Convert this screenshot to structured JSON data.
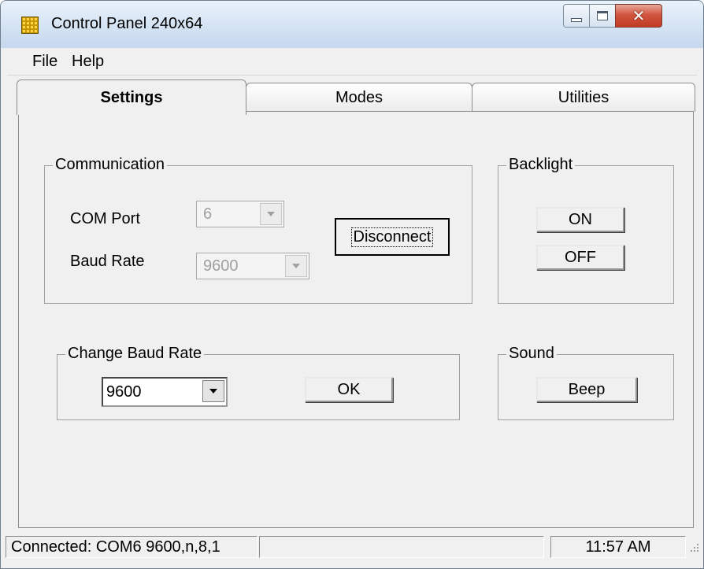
{
  "window": {
    "title": "Control Panel 240x64"
  },
  "menu": {
    "items": [
      "File",
      "Help"
    ]
  },
  "tabs": [
    "Settings",
    "Modes",
    "Utilities"
  ],
  "communication": {
    "title": "Communication",
    "com_port_label": "COM Port",
    "com_port_value": "6",
    "baud_rate_label": "Baud Rate",
    "baud_rate_value": "9600",
    "disconnect_label": "Disconnect"
  },
  "backlight": {
    "title": "Backlight",
    "on_label": "ON",
    "off_label": "OFF"
  },
  "change_baud": {
    "title": "Change Baud Rate",
    "value": "9600",
    "ok_label": "OK"
  },
  "sound": {
    "title": "Sound",
    "beep_label": "Beep"
  },
  "status": {
    "connection": "Connected: COM6 9600,n,8,1",
    "middle": "",
    "time": "11:57 AM"
  }
}
